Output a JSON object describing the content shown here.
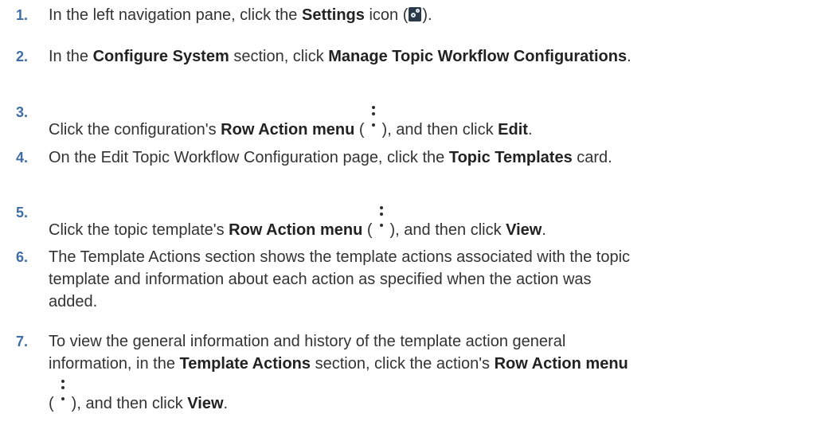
{
  "steps": [
    {
      "num": "1.",
      "parts": [
        {
          "t": "In the left navigation pane, click the "
        },
        {
          "b": "Settings"
        },
        {
          "t": " icon ("
        },
        {
          "icon": "settings-icon"
        },
        {
          "t": ")."
        }
      ]
    },
    {
      "num": "2.",
      "parts": [
        {
          "t": "In the "
        },
        {
          "b": "Configure System"
        },
        {
          "t": " section, click "
        },
        {
          "b": "Manage Topic Workflow Configurations"
        },
        {
          "t": "."
        }
      ]
    },
    {
      "num": "3.",
      "parts": [
        {
          "t": "Click the configuration's "
        },
        {
          "b": "Row Action menu"
        },
        {
          "t": " ("
        },
        {
          "icon": "row-action-menu-icon"
        },
        {
          "t": "), and then click "
        },
        {
          "b": "Edit"
        },
        {
          "t": "."
        }
      ]
    },
    {
      "num": "4.",
      "parts": [
        {
          "t": "On the Edit Topic Workflow Configuration page, click the "
        },
        {
          "b": "Topic Templates"
        },
        {
          "t": " card."
        }
      ]
    },
    {
      "num": "5.",
      "parts": [
        {
          "t": "Click the topic template's "
        },
        {
          "b": "Row Action menu"
        },
        {
          "t": " ("
        },
        {
          "icon": "row-action-menu-icon"
        },
        {
          "t": "), and then click "
        },
        {
          "b": "View"
        },
        {
          "t": "."
        }
      ]
    },
    {
      "num": "6.",
      "parts": [
        {
          "t": "The Template Actions section shows the template actions associated with the topic"
        },
        {
          "br": true
        },
        {
          "t": "template and information about each action as specified when the action was"
        },
        {
          "br": true
        },
        {
          "t": "added."
        }
      ]
    },
    {
      "num": "7.",
      "parts": [
        {
          "t": "To view the general information and history of the template action general"
        },
        {
          "br": true
        },
        {
          "t": "information, in the "
        },
        {
          "b": "Template Actions"
        },
        {
          "t": " section, click the action's "
        },
        {
          "b": "Row Action menu"
        },
        {
          "br": true
        },
        {
          "t": "("
        },
        {
          "icon": "row-action-menu-icon"
        },
        {
          "t": "), and then click "
        },
        {
          "b": "View"
        },
        {
          "t": "."
        }
      ]
    }
  ]
}
